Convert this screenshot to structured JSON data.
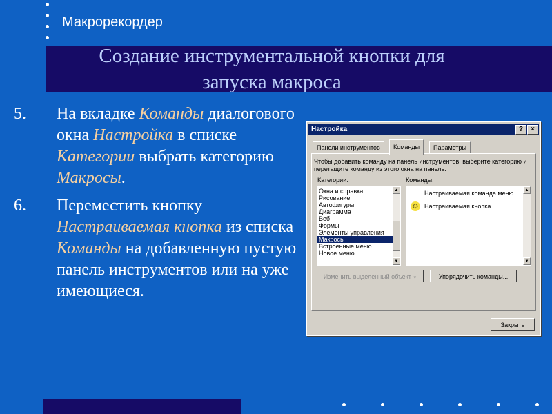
{
  "topic": "Макрорекордер",
  "title": {
    "line1": "Создание инструментальной кнопки для",
    "line2": "запуска макроса"
  },
  "steps": [
    {
      "num": "5.",
      "parts": [
        "На вкладке ",
        "Команды",
        " диалогового окна ",
        "Настройка",
        " в списке ",
        "Категории",
        " выбрать категорию ",
        "Макросы",
        "."
      ]
    },
    {
      "num": "6.",
      "parts": [
        "Переместить кнопку ",
        "Настраиваемая кнопка",
        " из списка ",
        "Команды",
        " на добавленную пустую панель инструментов или на уже имеющиеся."
      ]
    }
  ],
  "dialog": {
    "title": "Настройка",
    "help_btn": "?",
    "close_btn": "×",
    "tabs": [
      "Панели инструментов",
      "Команды",
      "Параметры"
    ],
    "instruction": "Чтобы добавить команду на панель инструментов, выберите категорию и перетащите команду из этого окна на панель.",
    "categories_label": "Категории:",
    "commands_label": "Команды:",
    "categories": [
      "Окна и справка",
      "Рисование",
      "Автофигуры",
      "Диаграмма",
      "Веб",
      "Формы",
      "Элементы управления",
      "Макросы",
      "Встроенные меню",
      "Новое меню"
    ],
    "selected_category": "Макросы",
    "commands": [
      "Настраиваемая команда меню",
      "Настраиваемая кнопка"
    ],
    "modify_btn": "Изменить выделенный объект",
    "modify_arrow": "▼",
    "rearrange_btn": "Упорядочить команды...",
    "close_dialog_btn": "Закрыть",
    "arrow_up": "▲",
    "arrow_down": "▼",
    "smiley": "☺"
  }
}
